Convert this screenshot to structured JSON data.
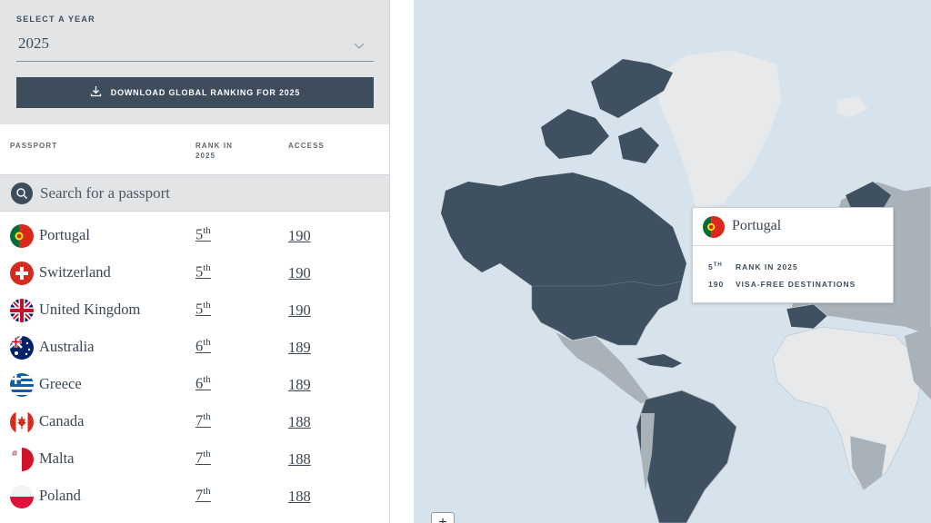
{
  "year_selector": {
    "label": "SELECT A YEAR",
    "value": "2025"
  },
  "download_button": {
    "label": "DOWNLOAD GLOBAL RANKING FOR 2025"
  },
  "table_header": {
    "passport": "PASSPORT",
    "rank": "RANK IN 2025",
    "access": "ACCESS"
  },
  "search": {
    "placeholder": "Search for a passport"
  },
  "passports": [
    {
      "country": "Portugal",
      "rank": "5",
      "suffix": "th",
      "access": "190",
      "flag": "portugal-flag"
    },
    {
      "country": "Switzerland",
      "rank": "5",
      "suffix": "th",
      "access": "190",
      "flag": "switzerland-flag"
    },
    {
      "country": "United Kingdom",
      "rank": "5",
      "suffix": "th",
      "access": "190",
      "flag": "uk-flag"
    },
    {
      "country": "Australia",
      "rank": "6",
      "suffix": "th",
      "access": "189",
      "flag": "australia-flag"
    },
    {
      "country": "Greece",
      "rank": "6",
      "suffix": "th",
      "access": "189",
      "flag": "greece-flag"
    },
    {
      "country": "Canada",
      "rank": "7",
      "suffix": "th",
      "access": "188",
      "flag": "canada-flag"
    },
    {
      "country": "Malta",
      "rank": "7",
      "suffix": "th",
      "access": "188",
      "flag": "malta-flag"
    },
    {
      "country": "Poland",
      "rank": "7",
      "suffix": "th",
      "access": "188",
      "flag": "poland-flag"
    }
  ],
  "tooltip": {
    "country": "Portugal",
    "rank_num": "5",
    "rank_suffix": "TH",
    "rank_text": "RANK IN 2025",
    "access_num": "190",
    "access_text": "VISA-FREE DESTINATIONS"
  },
  "map": {
    "zoom_in_label": "+"
  },
  "colors": {
    "accent": "#3e4d5c",
    "ocean": "#d6e2ec",
    "land_highlight": "#3f5060",
    "land_mid": "#a9b1b9",
    "land_light": "#e7e9eb"
  }
}
